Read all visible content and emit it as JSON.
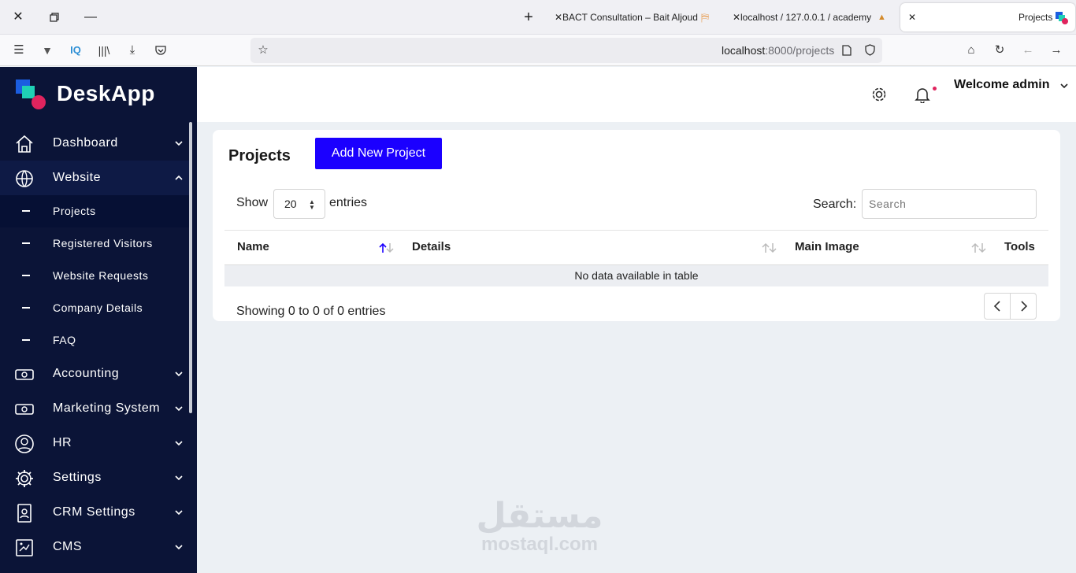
{
  "browser": {
    "tabs": [
      {
        "title": "BACT Consultation – Bait Aljoud"
      },
      {
        "title": "localhost / 127.0.0.1 / academy"
      },
      {
        "title": "Projects"
      }
    ],
    "url_host": "localhost",
    "url_path": ":8000/projects"
  },
  "sidebar": {
    "logo_text": "DeskApp",
    "items": [
      {
        "label": "Dashboard",
        "icon": "home-icon"
      },
      {
        "label": "Website",
        "icon": "globe-icon"
      },
      {
        "label": "Accounting",
        "icon": "cash-icon"
      },
      {
        "label": "Marketing System",
        "icon": "cash-icon"
      },
      {
        "label": "HR",
        "icon": "user-circle-icon"
      },
      {
        "label": "Settings",
        "icon": "gear-icon"
      },
      {
        "label": "CRM Settings",
        "icon": "id-badge-icon"
      },
      {
        "label": "CMS",
        "icon": "cms-icon"
      }
    ],
    "website_submenu": [
      {
        "label": "Projects"
      },
      {
        "label": "Registered Visitors"
      },
      {
        "label": "Website Requests"
      },
      {
        "label": "Company Details"
      },
      {
        "label": "FAQ"
      }
    ]
  },
  "header": {
    "welcome": "Welcome admin"
  },
  "main": {
    "title": "Projects",
    "add_button": "Add New Project",
    "show_label": "Show",
    "entries_value": "20",
    "entries_label": "entries",
    "search_label": "Search:",
    "search_placeholder": "Search",
    "columns": [
      "Name",
      "Details",
      "Main Image",
      "Tools"
    ],
    "empty_message": "No data available in table",
    "info": "Showing 0 to 0 of 0 entries"
  },
  "watermark": {
    "arabic": "مستقل",
    "latin": "mostaql.com"
  },
  "colors": {
    "sidebar_bg": "#0b1437",
    "accent": "#1b00ff",
    "notification_dot": "#e0245e"
  }
}
